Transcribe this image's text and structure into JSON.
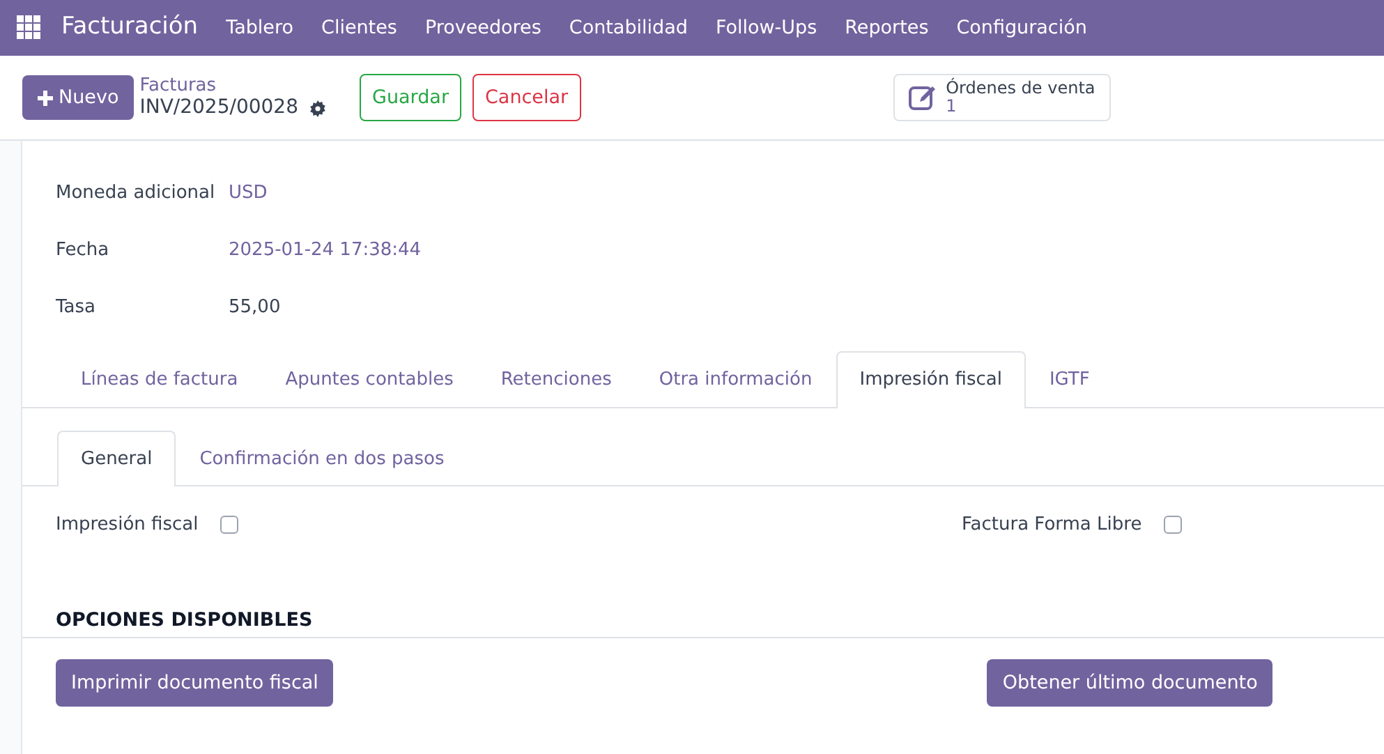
{
  "navbar": {
    "app_name": "Facturación",
    "menu": [
      "Tablero",
      "Clientes",
      "Proveedores",
      "Contabilidad",
      "Follow-Ups",
      "Reportes",
      "Configuración"
    ]
  },
  "control_panel": {
    "new_button": "Nuevo",
    "breadcrumb": "Facturas",
    "record_name": "INV/2025/00028",
    "save_button": "Guardar",
    "discard_button": "Cancelar",
    "smart_button": {
      "label": "Órdenes de venta",
      "count": "1"
    }
  },
  "fields": [
    {
      "label": "Moneda adicional",
      "value": "USD",
      "kind": "link"
    },
    {
      "label": "Fecha",
      "value": "2025-01-24 17:38:44",
      "kind": "link"
    },
    {
      "label": "Tasa",
      "value": "55,00",
      "kind": "text"
    }
  ],
  "tabs": [
    {
      "label": "Líneas de factura",
      "selected": false
    },
    {
      "label": "Apuntes contables",
      "selected": false
    },
    {
      "label": "Retenciones",
      "selected": false
    },
    {
      "label": "Otra información",
      "selected": false
    },
    {
      "label": "Impresión fiscal",
      "selected": true
    },
    {
      "label": "IGTF",
      "selected": false
    }
  ],
  "subtabs": [
    {
      "label": "General",
      "selected": true
    },
    {
      "label": "Confirmación en dos pasos",
      "selected": false
    }
  ],
  "checkboxes": [
    {
      "label": "Impresión fiscal",
      "checked": false
    },
    {
      "label": "Factura Forma Libre",
      "checked": false
    }
  ],
  "section": {
    "title": "OPCIONES DISPONIBLES",
    "buttons": [
      "Imprimir documento fiscal",
      "Obtener último documento"
    ]
  }
}
